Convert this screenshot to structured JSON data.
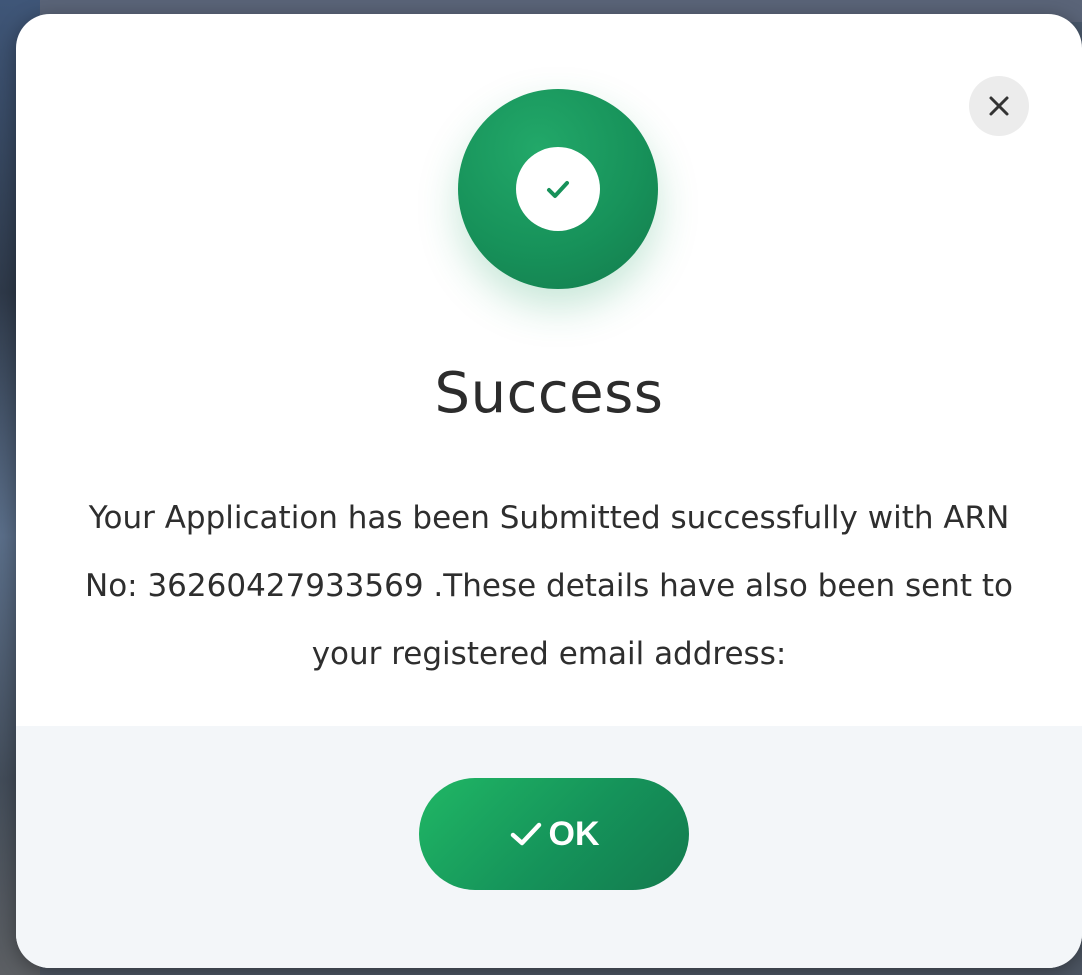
{
  "dialog": {
    "title": "Success",
    "message": "Your Application has been Submitted successfully with ARN No: 36260427933569 .These details have also been sent to your registered email address:",
    "close_icon": "close-icon",
    "status_icon": "check-circle-icon",
    "ok_button": {
      "label": "OK",
      "icon": "check-icon"
    }
  },
  "colors": {
    "accent": "#17925a",
    "footer_background": "#f3f6f9"
  }
}
